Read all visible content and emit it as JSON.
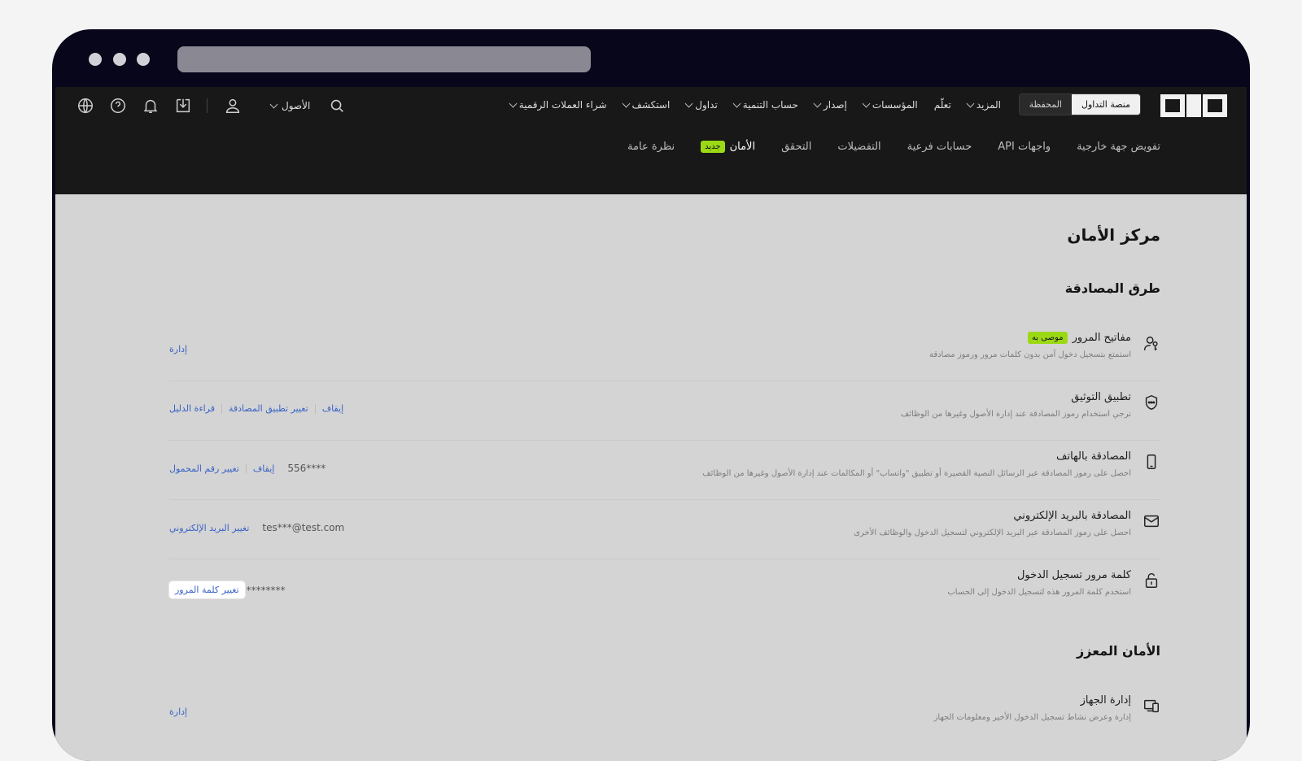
{
  "browser": {
    "url": ""
  },
  "topnav": {
    "logo": "OKX",
    "modes": {
      "exchange": "منصة التداول",
      "wallet": "المحفظة"
    },
    "menu": [
      {
        "label": "شراء العملات الرقمية",
        "chevron": true
      },
      {
        "label": "استكشف",
        "chevron": true
      },
      {
        "label": "تداول",
        "chevron": true
      },
      {
        "label": "حساب التنمية",
        "chevron": true
      },
      {
        "label": "إصدار",
        "chevron": true
      },
      {
        "label": "المؤسسات",
        "chevron": true
      },
      {
        "label": "تعلّم",
        "chevron": false
      },
      {
        "label": "المزيد",
        "chevron": true
      }
    ],
    "assets_label": "الأصول",
    "icons": [
      "globe-icon",
      "help-icon",
      "bell-icon",
      "download-icon",
      "user-icon",
      "search-icon"
    ]
  },
  "subnav": {
    "tabs": [
      {
        "label": "نظرة عامة",
        "active": false
      },
      {
        "label": "الأمان",
        "active": true,
        "badge": "جديد"
      },
      {
        "label": "التحقق",
        "active": false
      },
      {
        "label": "التفضيلات",
        "active": false
      },
      {
        "label": "حسابات فرعية",
        "active": false
      },
      {
        "label": "واجهات API",
        "active": false
      },
      {
        "label": "تفويض جهة خارجية",
        "active": false
      }
    ]
  },
  "page": {
    "title": "مركز الأمان",
    "auth_section": "طرق المصادقة",
    "advanced_section": "الأمان المعزز"
  },
  "auth_methods": [
    {
      "icon": "passkey-icon",
      "title": "مفاتيح المرور",
      "badge": "موصى به",
      "desc": "استمتع بتسجيل دخول آمن بدون كلمات مرور ورموز مصادقة",
      "value": "",
      "actions": [
        "إدارة"
      ]
    },
    {
      "icon": "authenticator-icon",
      "title": "تطبيق التوثيق",
      "desc": "نرجي استخدام رموز المصادقة عند إدارة الأصول وغيرها من الوظائف",
      "value": "",
      "actions": [
        "قراءة الدليل",
        "تغيير تطبيق المصادقة",
        "إيقاف"
      ]
    },
    {
      "icon": "phone-icon",
      "title": "المصادقة بالهاتف",
      "desc": "احصل على رموز المصادقة عبر الرسائل النصية القصيرة أو تطبيق \"واتساب\" أو المكالمات عند إدارة الأصول وغيرها من الوظائف",
      "value": "556****",
      "actions": [
        "تغيير رقم المحمول",
        "إيقاف"
      ]
    },
    {
      "icon": "email-icon",
      "title": "المصادقة بالبريد الإلكتروني",
      "desc": "احصل على رموز المصادقة عبر البريد الإلكتروني لتسجيل الدخول والوظائف الأخرى",
      "value": "tes***@test.com",
      "actions": [
        "تغيير البريد الإلكتروني"
      ]
    },
    {
      "icon": "lock-icon",
      "title": "كلمة مرور تسجيل الدخول",
      "desc": "استخدم كلمة المرور هذه لتسجيل الدخول إلى الحساب",
      "value": "********",
      "actions": [
        "تغيير كلمة المرور"
      ]
    }
  ],
  "advanced_methods": [
    {
      "icon": "device-icon",
      "title": "إدارة الجهاز",
      "desc": "إدارة وعرض نشاط تسجيل الدخول الأخير ومعلومات الجهاز",
      "actions": [
        "إدارة"
      ]
    }
  ],
  "colors": {
    "accent_badge": "#9bd915",
    "link": "#3a62c6",
    "nav_bg": "#181818",
    "content_bg": "#d4d4d4"
  }
}
